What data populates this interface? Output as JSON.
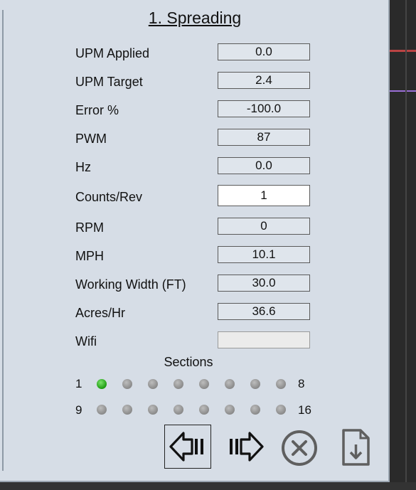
{
  "panel": {
    "title": "1. Spreading"
  },
  "fields": [
    {
      "label": "UPM Applied",
      "value": "0.0"
    },
    {
      "label": "UPM Target",
      "value": "2.4"
    },
    {
      "label": "Error %",
      "value": "-100.0"
    },
    {
      "label": "PWM",
      "value": "87"
    },
    {
      "label": "Hz",
      "value": "0.0"
    },
    {
      "label": "Counts/Rev",
      "value": "1"
    },
    {
      "label": "RPM",
      "value": "0"
    },
    {
      "label": "MPH",
      "value": "10.1"
    },
    {
      "label": "Working Width (FT)",
      "value": "30.0"
    },
    {
      "label": "Acres/Hr",
      "value": "36.6"
    },
    {
      "label": "Wifi",
      "value": ""
    }
  ],
  "sections": {
    "title": "Sections",
    "row1_start": "1",
    "row1_end": "8",
    "row2_start": "9",
    "row2_end": "16",
    "active": [
      true,
      false,
      false,
      false,
      false,
      false,
      false,
      false,
      false,
      false,
      false,
      false,
      false,
      false,
      false,
      false
    ]
  },
  "colors": {
    "active_section": "#1e9b12",
    "inactive_section": "#8a8a8a",
    "icon_gray": "#666666"
  },
  "toolbar": {
    "icons": [
      "previous-icon",
      "next-icon",
      "cancel-icon",
      "save-icon"
    ]
  }
}
